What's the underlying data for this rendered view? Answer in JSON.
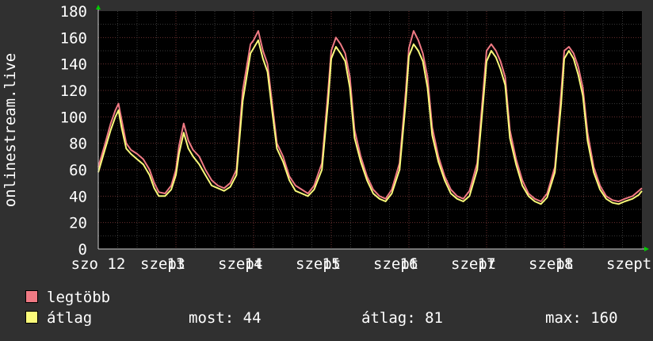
{
  "chart_data": {
    "type": "line",
    "ylabel": "onlinestream.live",
    "ylim": [
      0,
      180
    ],
    "yticks": [
      0,
      20,
      40,
      60,
      80,
      100,
      120,
      140,
      160,
      180
    ],
    "xlim": [
      0,
      7
    ],
    "xtick_labels": [
      {
        "x": 0,
        "label": "szo 12"
      },
      {
        "x": 0.833,
        "label": "szept"
      },
      {
        "x": 1,
        "label": "13"
      },
      {
        "x": 1.833,
        "label": "szept"
      },
      {
        "x": 2,
        "label": "14"
      },
      {
        "x": 2.833,
        "label": "szept"
      },
      {
        "x": 3,
        "label": "15"
      },
      {
        "x": 3.833,
        "label": "szept"
      },
      {
        "x": 4,
        "label": "16"
      },
      {
        "x": 4.833,
        "label": "szept"
      },
      {
        "x": 5,
        "label": "17"
      },
      {
        "x": 5.833,
        "label": "szept"
      },
      {
        "x": 6,
        "label": "18"
      },
      {
        "x": 6.833,
        "label": "szept"
      }
    ],
    "grid": true,
    "series": [
      {
        "name": "legtöbb",
        "color": "#f07a84",
        "x": [
          0,
          0.08,
          0.16,
          0.22,
          0.26,
          0.3,
          0.36,
          0.42,
          0.5,
          0.58,
          0.66,
          0.72,
          0.78,
          0.86,
          0.94,
          1.0,
          1.04,
          1.1,
          1.16,
          1.22,
          1.3,
          1.38,
          1.46,
          1.54,
          1.62,
          1.7,
          1.78,
          1.86,
          1.96,
          2.0,
          2.06,
          2.12,
          2.18,
          2.24,
          2.3,
          2.38,
          2.46,
          2.54,
          2.62,
          2.7,
          2.78,
          2.88,
          2.96,
          3.0,
          3.06,
          3.12,
          3.18,
          3.24,
          3.3,
          3.38,
          3.46,
          3.54,
          3.62,
          3.7,
          3.78,
          3.88,
          3.96,
          4.0,
          4.06,
          4.12,
          4.18,
          4.24,
          4.3,
          4.38,
          4.46,
          4.54,
          4.62,
          4.7,
          4.78,
          4.88,
          4.96,
          5.0,
          5.06,
          5.12,
          5.18,
          5.24,
          5.3,
          5.38,
          5.46,
          5.54,
          5.62,
          5.7,
          5.78,
          5.88,
          5.96,
          6.0,
          6.06,
          6.12,
          6.18,
          6.24,
          6.3,
          6.38,
          6.46,
          6.54,
          6.62,
          6.7,
          6.78,
          6.88,
          6.96,
          7.0
        ],
        "values": [
          62,
          78,
          95,
          105,
          110,
          98,
          80,
          75,
          72,
          68,
          60,
          50,
          43,
          42,
          48,
          60,
          78,
          95,
          82,
          75,
          70,
          60,
          52,
          48,
          46,
          50,
          60,
          120,
          155,
          158,
          165,
          150,
          140,
          110,
          80,
          70,
          55,
          48,
          45,
          42,
          48,
          65,
          120,
          150,
          160,
          155,
          148,
          130,
          90,
          70,
          55,
          45,
          40,
          38,
          45,
          65,
          120,
          152,
          165,
          158,
          148,
          130,
          92,
          70,
          55,
          45,
          40,
          38,
          44,
          65,
          122,
          150,
          155,
          150,
          142,
          130,
          90,
          68,
          52,
          42,
          38,
          36,
          42,
          62,
          118,
          150,
          153,
          148,
          138,
          122,
          88,
          62,
          48,
          40,
          37,
          36,
          38,
          40,
          44,
          46
        ]
      },
      {
        "name": "átlag",
        "color": "#fafa7a",
        "x": [
          0,
          0.08,
          0.16,
          0.22,
          0.26,
          0.3,
          0.36,
          0.42,
          0.5,
          0.58,
          0.66,
          0.72,
          0.78,
          0.86,
          0.94,
          1.0,
          1.04,
          1.1,
          1.16,
          1.22,
          1.3,
          1.38,
          1.46,
          1.54,
          1.62,
          1.7,
          1.78,
          1.86,
          1.96,
          2.0,
          2.06,
          2.12,
          2.18,
          2.24,
          2.3,
          2.38,
          2.46,
          2.54,
          2.62,
          2.7,
          2.78,
          2.88,
          2.96,
          3.0,
          3.06,
          3.12,
          3.18,
          3.24,
          3.3,
          3.38,
          3.46,
          3.54,
          3.62,
          3.7,
          3.78,
          3.88,
          3.96,
          4.0,
          4.06,
          4.12,
          4.18,
          4.24,
          4.3,
          4.38,
          4.46,
          4.54,
          4.62,
          4.7,
          4.78,
          4.88,
          4.96,
          5.0,
          5.06,
          5.12,
          5.18,
          5.24,
          5.3,
          5.38,
          5.46,
          5.54,
          5.62,
          5.7,
          5.78,
          5.88,
          5.96,
          6.0,
          6.06,
          6.12,
          6.18,
          6.24,
          6.3,
          6.38,
          6.46,
          6.54,
          6.62,
          6.7,
          6.78,
          6.88,
          6.96,
          7.0
        ],
        "values": [
          58,
          74,
          90,
          100,
          105,
          92,
          76,
          72,
          68,
          64,
          56,
          46,
          40,
          40,
          45,
          56,
          72,
          88,
          76,
          70,
          64,
          56,
          48,
          46,
          44,
          47,
          56,
          112,
          148,
          152,
          158,
          144,
          134,
          104,
          76,
          66,
          52,
          44,
          42,
          40,
          45,
          60,
          112,
          144,
          153,
          148,
          142,
          122,
          84,
          66,
          52,
          42,
          38,
          36,
          42,
          60,
          112,
          146,
          155,
          150,
          142,
          122,
          86,
          66,
          52,
          42,
          38,
          36,
          40,
          60,
          114,
          142,
          150,
          145,
          136,
          124,
          84,
          64,
          48,
          40,
          36,
          34,
          39,
          58,
          110,
          144,
          150,
          144,
          132,
          116,
          82,
          58,
          45,
          38,
          35,
          34,
          36,
          38,
          41,
          44
        ]
      }
    ]
  },
  "legend": {
    "max_label": "legtöbb",
    "avg_label": "átlag",
    "max_color": "#f07a84",
    "avg_color": "#fafa7a"
  },
  "stats": {
    "now_text": "most: 44",
    "avg_text": "átlag: 81",
    "max_text": "max: 160"
  }
}
